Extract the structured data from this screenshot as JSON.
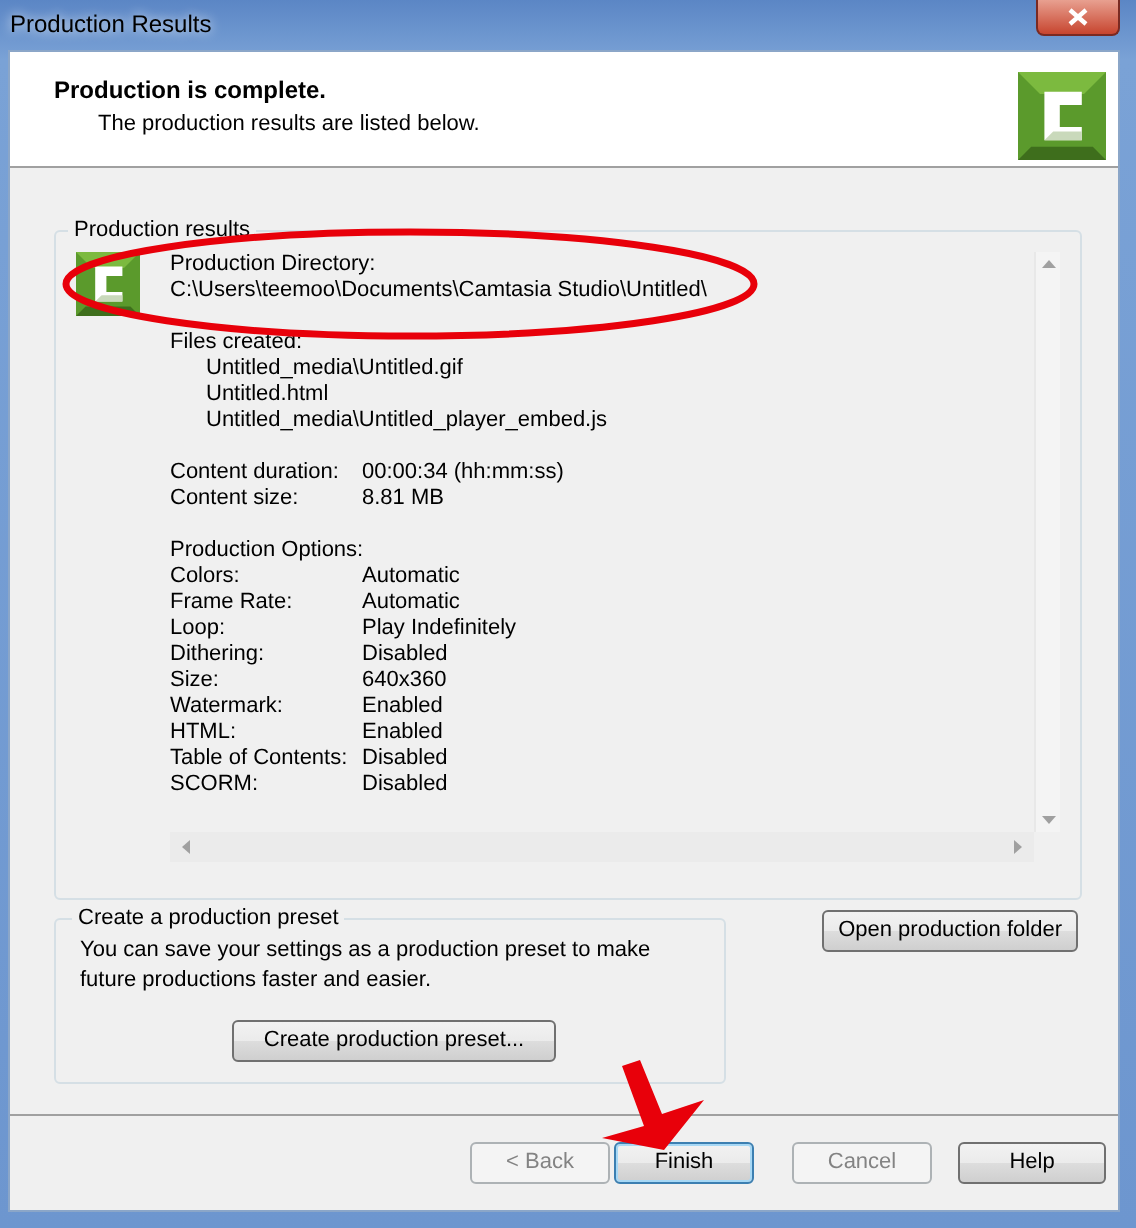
{
  "window": {
    "title": "Production Results"
  },
  "header": {
    "title": "Production is complete.",
    "subtitle": "The production results are listed below."
  },
  "results": {
    "label": "Production results",
    "directory_label": "Production Directory:",
    "directory": "C:\\Users\\teemoo\\Documents\\Camtasia Studio\\Untitled\\",
    "files_label": "Files created:",
    "files": [
      "Untitled_media\\Untitled.gif",
      "Untitled.html",
      "Untitled_media\\Untitled_player_embed.js"
    ],
    "details": [
      {
        "label": "Content duration:",
        "value": "00:00:34 (hh:mm:ss)"
      },
      {
        "label": "Content size:",
        "value": "8.81 MB"
      }
    ],
    "options_label": "Production Options:",
    "options": [
      {
        "label": "Colors:",
        "value": "Automatic"
      },
      {
        "label": "Frame Rate:",
        "value": "Automatic"
      },
      {
        "label": "Loop:",
        "value": "Play Indefinitely"
      },
      {
        "label": "Dithering:",
        "value": "Disabled"
      },
      {
        "label": "Size:",
        "value": "640x360"
      },
      {
        "label": "Watermark:",
        "value": "Enabled"
      },
      {
        "label": "HTML:",
        "value": "Enabled"
      },
      {
        "label": "Table of Contents:",
        "value": "Disabled"
      },
      {
        "label": "SCORM:",
        "value": "Disabled"
      }
    ]
  },
  "preset": {
    "label": "Create a production preset",
    "description": "You can save your settings as a production preset to make future productions faster and easier.",
    "button": "Create production preset..."
  },
  "open_folder_button": "Open production folder",
  "buttons": [
    {
      "label": "< Back",
      "disabled": true,
      "focused": false
    },
    {
      "label": "Finish",
      "disabled": false,
      "focused": true
    },
    {
      "label": "Cancel",
      "disabled": true,
      "focused": false
    },
    {
      "label": "Help",
      "disabled": false,
      "focused": false
    }
  ],
  "annotations": [
    {
      "kind": "ellipse"
    },
    {
      "kind": "arrow"
    }
  ]
}
